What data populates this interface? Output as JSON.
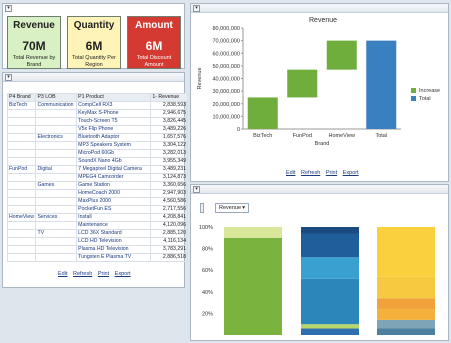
{
  "kpis": [
    {
      "title": "Revenue",
      "value": "70M",
      "desc": "Total Revenue by Brand",
      "bg": "#d9f0c4"
    },
    {
      "title": "Quantity",
      "value": "6M",
      "desc": "Total Quantity Per Region",
      "bg": "#fff4b8"
    },
    {
      "title": "Amount",
      "value": "6M",
      "desc": "Total Discount Amount",
      "bg": "#d43a32"
    }
  ],
  "table": {
    "headers": [
      "P4 Brand",
      "P3 LOB",
      "P1 Product",
      "1- Revenue"
    ],
    "rows": [
      [
        "BizTech",
        "Communication",
        "CompCell RX3",
        "2,838,593"
      ],
      [
        "",
        "",
        "KeyMax S-Phone",
        "2,946,675"
      ],
      [
        "",
        "",
        "Touch-Screen T5",
        "3,826,445"
      ],
      [
        "",
        "",
        "V5x Flip Phone",
        "3,489,226"
      ],
      [
        "",
        "Electronics",
        "Bluetooth Adaptor",
        "1,657,576"
      ],
      [
        "",
        "",
        "MP3 Speakers System",
        "3,304,122"
      ],
      [
        "",
        "",
        "MicroPod 60Gb",
        "3,282,013"
      ],
      [
        "",
        "",
        "SoundX Nano 4Gb",
        "3,955,349"
      ],
      [
        "FunPod",
        "Digital",
        "7 Megapixel Digital Camera",
        "3,489,231"
      ],
      [
        "",
        "",
        "MPEG4 Camcorder",
        "3,124,873"
      ],
      [
        "",
        "Games",
        "Game Station",
        "3,360,656"
      ],
      [
        "",
        "",
        "HomeCoach 2000",
        "2,947,903"
      ],
      [
        "",
        "",
        "MaxPlus 2000",
        "4,560,586"
      ],
      [
        "",
        "",
        "PocketFun ES",
        "2,717,556"
      ],
      [
        "HomeView",
        "Services",
        "Install",
        "4,208,841"
      ],
      [
        "",
        "",
        "Maintenance",
        "4,120,096"
      ],
      [
        "",
        "TV",
        "LCD 36X Standard",
        "2,885,120"
      ],
      [
        "",
        "",
        "LCD HD Television",
        "4,116,134"
      ],
      [
        "",
        "",
        "Plasma HD Television",
        "3,783,291"
      ],
      [
        "",
        "",
        "Tungsten E Plasma TV",
        "2,886,518"
      ]
    ]
  },
  "links": {
    "edit": "Edit",
    "refresh": "Refresh",
    "print": "Print",
    "export": "Export"
  },
  "waterfall": {
    "title": "Revenue",
    "y_label": "Revenue",
    "x_label": "Brand",
    "legend": [
      "Increase",
      "Total"
    ]
  },
  "selector": {
    "label": "Revenue"
  },
  "chart_data": [
    {
      "type": "bar",
      "subtype": "waterfall",
      "title": "Revenue",
      "xlabel": "Brand",
      "ylabel": "Revenue",
      "categories": [
        "BizTech",
        "FunPod",
        "HomeView",
        "Total"
      ],
      "series": [
        {
          "name": "Increase",
          "color": "#6fae3c",
          "values": [
            25000000,
            22000000,
            23000000,
            null
          ]
        },
        {
          "name": "Total",
          "color": "#3a7fbf",
          "values": [
            null,
            null,
            null,
            70000000
          ]
        }
      ],
      "ylim": [
        0,
        80000000
      ],
      "yticks": [
        "0",
        "10,000,000",
        "20,000,000",
        "30,000,000",
        "40,000,000",
        "50,000,000",
        "60,000,000",
        "70,000,000",
        "80,000,000"
      ],
      "legend_position": "right"
    },
    {
      "type": "bar",
      "subtype": "stacked-100",
      "yticks": [
        "20%",
        "40%",
        "60%",
        "80%",
        "100%"
      ],
      "ylim": [
        0,
        100
      ],
      "stacks": [
        {
          "segments": [
            {
              "v": 90,
              "c": "#7bb33f"
            },
            {
              "v": 10,
              "c": "#d9e79a"
            }
          ]
        },
        {
          "segments": [
            {
              "v": 6,
              "c": "#2f6fb0"
            },
            {
              "v": 4,
              "c": "#b7d76a"
            },
            {
              "v": 42,
              "c": "#2c86b9"
            },
            {
              "v": 20,
              "c": "#3aa0cf"
            },
            {
              "v": 22,
              "c": "#1f5e9a"
            },
            {
              "v": 6,
              "c": "#1b4a80"
            }
          ]
        },
        {
          "segments": [
            {
              "v": 6,
              "c": "#4f7fa0"
            },
            {
              "v": 8,
              "c": "#7ea4b8"
            },
            {
              "v": 10,
              "c": "#f3b03a"
            },
            {
              "v": 10,
              "c": "#f1a23a"
            },
            {
              "v": 20,
              "c": "#f7c940"
            },
            {
              "v": 46,
              "c": "#fbd03f"
            }
          ]
        }
      ]
    }
  ]
}
